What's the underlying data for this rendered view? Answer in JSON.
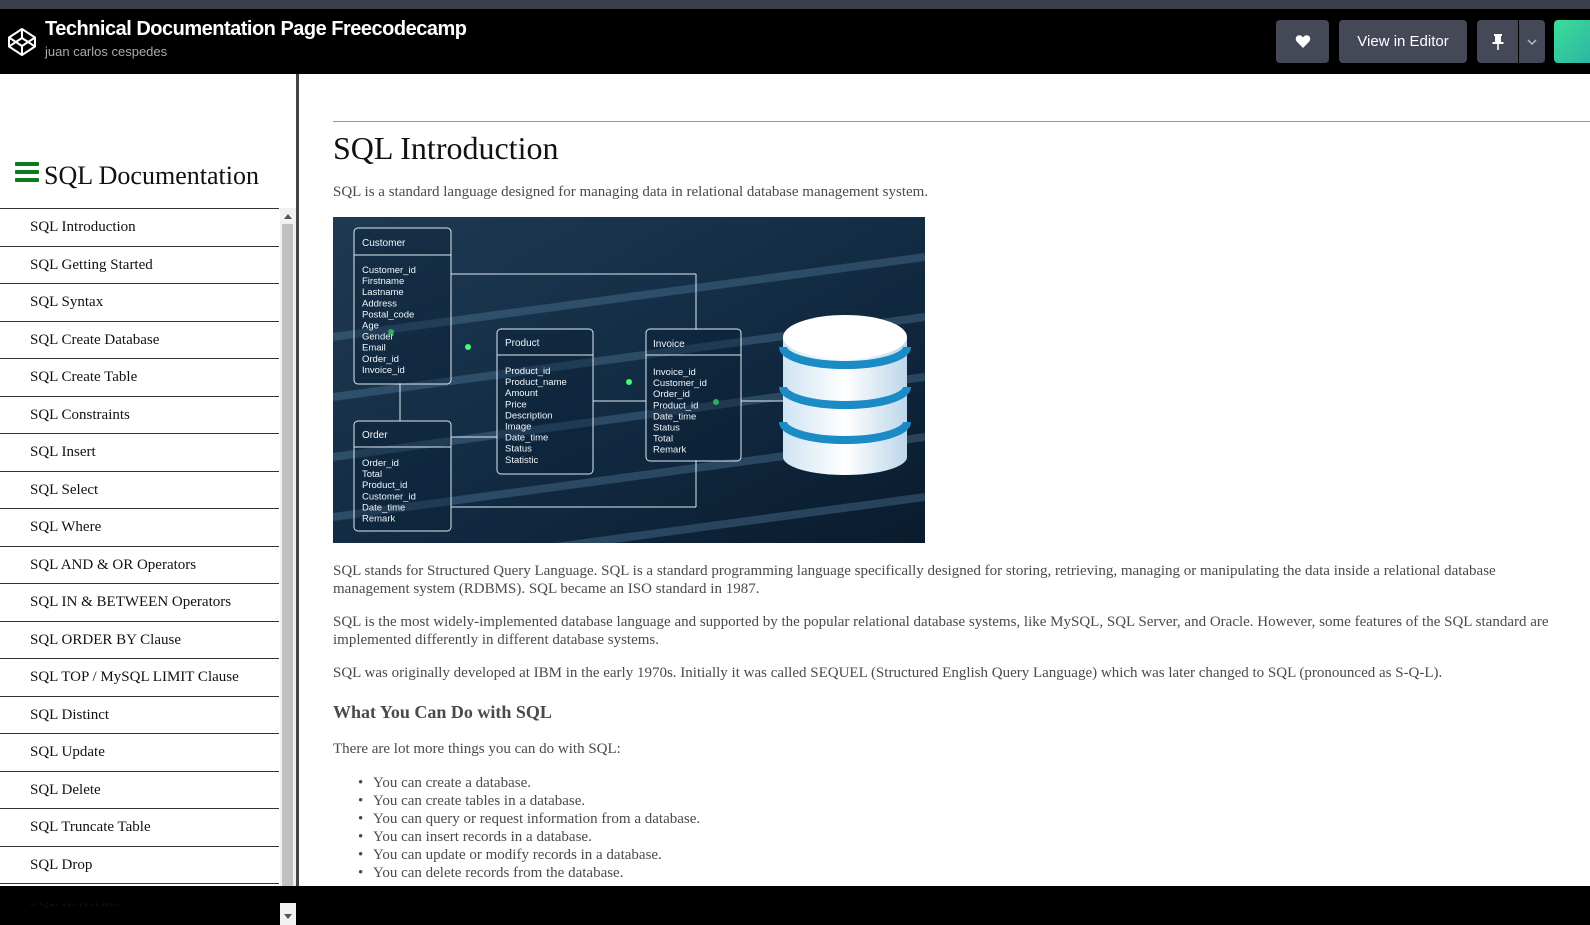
{
  "header": {
    "title": "Technical Documentation Page Freecodecamp",
    "author": "juan carlos cespedes",
    "view_in_editor": "View in Editor",
    "icons": [
      "codepen-logo-icon",
      "heart-icon",
      "pin-icon",
      "chevron-down-icon"
    ]
  },
  "sidebar": {
    "title": "SQL Documentation",
    "items": [
      "SQL Introduction",
      "SQL Getting Started",
      "SQL Syntax",
      "SQL Create Database",
      "SQL Create Table",
      "SQL Constraints",
      "SQL Insert",
      "SQL Select",
      "SQL Where",
      "SQL AND & OR Operators",
      "SQL IN & BETWEEN Operators",
      "SQL ORDER BY Clause",
      "SQL TOP / MySQL LIMIT Clause",
      "SQL Distinct",
      "SQL Update",
      "SQL Delete",
      "SQL Truncate Table",
      "SQL Drop",
      "SQL Reference"
    ]
  },
  "main": {
    "heading": "SQL Introduction",
    "intro": "SQL is a standard language designed for managing data in relational database management system.",
    "image": {
      "tables": [
        {
          "name": "Customer",
          "fields": [
            "Customer_id",
            "Firstname",
            "Lastname",
            "Address",
            "Postal_code",
            "Age",
            "Gender",
            "Email",
            "Order_id",
            "Invoice_id"
          ]
        },
        {
          "name": "Product",
          "fields": [
            "Product_id",
            "Product_name",
            "Amount",
            "Price",
            "Description",
            "Image",
            "Date_time",
            "Status",
            "Statistic"
          ]
        },
        {
          "name": "Invoice",
          "fields": [
            "Invoice_id",
            "Customer_id",
            "Order_id",
            "Product_id",
            "Date_time",
            "Status",
            "Total",
            "Remark"
          ]
        },
        {
          "name": "Order",
          "fields": [
            "Order_id",
            "Total",
            "Product_id",
            "Customer_id",
            "Date_time",
            "Remark"
          ]
        }
      ]
    },
    "p1": "SQL stands for Structured Query Language. SQL is a standard programming language specifically designed for storing, retrieving, managing or manipulating the data inside a relational database management system (RDBMS). SQL became an ISO standard in 1987.",
    "p2": "SQL is the most widely-implemented database language and supported by the popular relational database systems, like MySQL, SQL Server, and Oracle. However, some features of the SQL standard are implemented differently in different database systems.",
    "p3": "SQL was originally developed at IBM in the early 1970s. Initially it was called SEQUEL (Structured English Query Language) which was later changed to SQL (pronounced as S-Q-L).",
    "subheading": "What You Can Do with SQL",
    "p4": "There are lot more things you can do with SQL:",
    "list": [
      "You can create a database.",
      "You can create tables in a database.",
      "You can query or request information from a database.",
      "You can insert records in a database.",
      "You can update or modify records in a database.",
      "You can delete records from the database."
    ]
  }
}
